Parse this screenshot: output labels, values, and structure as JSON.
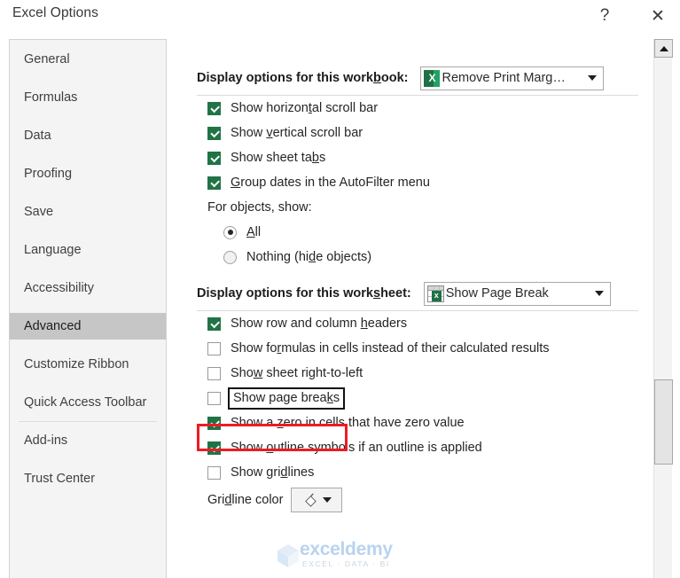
{
  "window": {
    "title": "Excel Options",
    "help_icon": "question-mark-icon",
    "help_label": "?",
    "close_icon": "close-icon",
    "close_label": "✕"
  },
  "sidebar": {
    "items": [
      {
        "label": "General",
        "selected": false
      },
      {
        "label": "Formulas",
        "selected": false
      },
      {
        "label": "Data",
        "selected": false
      },
      {
        "label": "Proofing",
        "selected": false
      },
      {
        "label": "Save",
        "selected": false
      },
      {
        "label": "Language",
        "selected": false
      },
      {
        "label": "Accessibility",
        "selected": false
      },
      {
        "label": "Advanced",
        "selected": true
      },
      {
        "label": "Customize Ribbon",
        "selected": false
      },
      {
        "label": "Quick Access Toolbar",
        "selected": false
      },
      {
        "label": "Add-ins",
        "selected": false
      },
      {
        "label": "Trust Center",
        "selected": false
      }
    ]
  },
  "workbook_section": {
    "title_before": "Display options for this work",
    "title_accel": "b",
    "title_after": "ook:",
    "combo": {
      "icon": "excel-workbook-icon",
      "icon_glyph": "X",
      "value": "Remove Print Marg…"
    },
    "options": [
      {
        "before": "Show horizon",
        "accel": "t",
        "after": "al scroll bar",
        "checked": true
      },
      {
        "before": "Show ",
        "accel": "v",
        "after": "ertical scroll bar",
        "checked": true
      },
      {
        "before": "Show sheet ta",
        "accel": "b",
        "after": "s",
        "checked": true
      },
      {
        "before": "",
        "accel": "G",
        "after": "roup dates in the AutoFilter menu",
        "checked": true
      }
    ],
    "objects_label": "For objects, show:",
    "objects_options": [
      {
        "before": "",
        "accel": "A",
        "after": "ll",
        "selected": true
      },
      {
        "before": "Nothing (hi",
        "accel": "d",
        "after": "e objects)",
        "selected": false
      }
    ]
  },
  "worksheet_section": {
    "title_before": "Display options for this work",
    "title_accel": "s",
    "title_after": "heet:",
    "combo": {
      "icon": "excel-worksheet-icon",
      "icon_glyph": "x",
      "value": "Show Page Break"
    },
    "options": [
      {
        "before": "Show row and column ",
        "accel": "h",
        "after": "eaders",
        "checked": true,
        "focused": false
      },
      {
        "before": "Show fo",
        "accel": "r",
        "after": "mulas in cells instead of their calculated results",
        "checked": false,
        "focused": false
      },
      {
        "before": "Sho",
        "accel": "w",
        "after": " sheet right-to-left",
        "checked": false,
        "focused": false
      },
      {
        "before": "Show page brea",
        "accel": "k",
        "after": "s",
        "checked": false,
        "focused": true
      },
      {
        "before": "Show a ",
        "accel": "z",
        "after": "ero in cells that have zero value",
        "checked": true,
        "focused": false
      },
      {
        "before": "Show ",
        "accel": "o",
        "after": "utline symbols if an outline is applied",
        "checked": true,
        "focused": false
      },
      {
        "before": "Show gri",
        "accel": "d",
        "after": "lines",
        "checked": false,
        "focused": false
      }
    ],
    "gridline_color": {
      "label_before": "Gri",
      "label_accel": "d",
      "label_after": "line color",
      "button_icon": "fill-color-icon"
    }
  },
  "scrollbar": {
    "up_icon": "scroll-up-arrow-icon",
    "thumb_name": "scroll-thumb"
  },
  "annotation": {
    "highlight_color": "#EE1B24",
    "target": "Show page breaks"
  },
  "watermark": {
    "name": "exceldemy",
    "subtitle": "EXCEL · DATA · BI",
    "logo_icon": "cube-logo-icon"
  }
}
